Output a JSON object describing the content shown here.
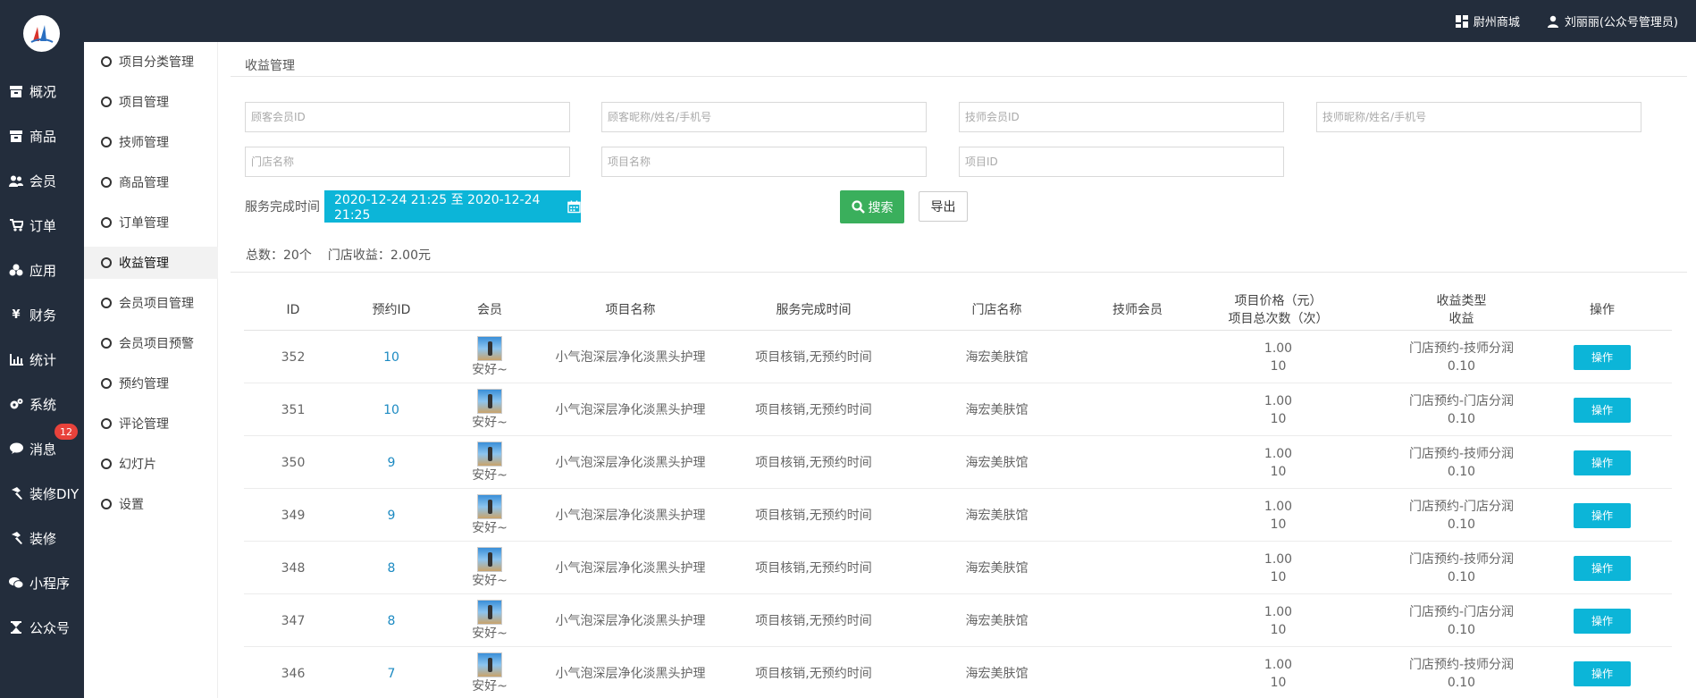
{
  "header": {
    "shop_label": "尉州商城",
    "user_label": "刘丽丽(公众号管理员)"
  },
  "leftnav": {
    "items": [
      {
        "label": "概况",
        "icon": "dashboard-icon"
      },
      {
        "label": "商品",
        "icon": "goods-icon"
      },
      {
        "label": "会员",
        "icon": "users-icon"
      },
      {
        "label": "订单",
        "icon": "cart-icon"
      },
      {
        "label": "应用",
        "icon": "apps-icon"
      },
      {
        "label": "财务",
        "icon": "yen-icon"
      },
      {
        "label": "统计",
        "icon": "chart-icon"
      },
      {
        "label": "系统",
        "icon": "gear-icon"
      },
      {
        "label": "消息",
        "icon": "message-icon"
      },
      {
        "label": "装修DIY",
        "icon": "hammer-icon"
      },
      {
        "label": "装修",
        "icon": "hammer-icon"
      },
      {
        "label": "小程序",
        "icon": "wechat-icon"
      },
      {
        "label": "公众号",
        "icon": "hourglass-icon"
      }
    ],
    "message_badge": "12"
  },
  "subnav": {
    "items": [
      {
        "label": "项目分类管理"
      },
      {
        "label": "项目管理"
      },
      {
        "label": "技师管理"
      },
      {
        "label": "商品管理"
      },
      {
        "label": "订单管理"
      },
      {
        "label": "收益管理"
      },
      {
        "label": "会员项目管理"
      },
      {
        "label": "会员项目预警"
      },
      {
        "label": "预约管理"
      },
      {
        "label": "评论管理"
      },
      {
        "label": "幻灯片"
      },
      {
        "label": "设置"
      }
    ],
    "active_index": 5
  },
  "page": {
    "title": "收益管理"
  },
  "filters": {
    "customer_id": {
      "placeholder": "顾客会员ID",
      "value": ""
    },
    "customer_name": {
      "placeholder": "顾客昵称/姓名/手机号",
      "value": ""
    },
    "tech_id": {
      "placeholder": "技师会员ID",
      "value": ""
    },
    "tech_name": {
      "placeholder": "技师昵称/姓名/手机号",
      "value": ""
    },
    "store_name": {
      "placeholder": "门店名称",
      "value": ""
    },
    "project_name": {
      "placeholder": "项目名称",
      "value": ""
    },
    "project_id": {
      "placeholder": "项目ID",
      "value": ""
    },
    "date_label": "服务完成时间",
    "date_range": "2020-12-24 21:25 至 2020-12-24 21:25",
    "search_label": "搜索",
    "export_label": "导出"
  },
  "summary": {
    "total": "总数：20个",
    "store_income": "门店收益：2.00元"
  },
  "table": {
    "headers": {
      "id": "ID",
      "booking_id": "预约ID",
      "member": "会员",
      "project_name": "项目名称",
      "finish_time": "服务完成时间",
      "store_name": "门店名称",
      "tech_member": "技师会员",
      "price_line1": "项目价格（元）",
      "price_line2": "项目总次数（次）",
      "type_line1": "收益类型",
      "type_line2": "收益",
      "action": "操作"
    },
    "rows": [
      {
        "id": "352",
        "booking_id": "10",
        "member": "安好~",
        "project": "小气泡深层净化淡黑头护理",
        "finish": "项目核销,无预约时间",
        "store": "海宏美肤馆",
        "tech": "",
        "price": "1.00",
        "count": "10",
        "type": "门店预约-技师分润",
        "income": "0.10",
        "action": "操作"
      },
      {
        "id": "351",
        "booking_id": "10",
        "member": "安好~",
        "project": "小气泡深层净化淡黑头护理",
        "finish": "项目核销,无预约时间",
        "store": "海宏美肤馆",
        "tech": "",
        "price": "1.00",
        "count": "10",
        "type": "门店预约-门店分润",
        "income": "0.10",
        "action": "操作"
      },
      {
        "id": "350",
        "booking_id": "9",
        "member": "安好~",
        "project": "小气泡深层净化淡黑头护理",
        "finish": "项目核销,无预约时间",
        "store": "海宏美肤馆",
        "tech": "",
        "price": "1.00",
        "count": "10",
        "type": "门店预约-技师分润",
        "income": "0.10",
        "action": "操作"
      },
      {
        "id": "349",
        "booking_id": "9",
        "member": "安好~",
        "project": "小气泡深层净化淡黑头护理",
        "finish": "项目核销,无预约时间",
        "store": "海宏美肤馆",
        "tech": "",
        "price": "1.00",
        "count": "10",
        "type": "门店预约-门店分润",
        "income": "0.10",
        "action": "操作"
      },
      {
        "id": "348",
        "booking_id": "8",
        "member": "安好~",
        "project": "小气泡深层净化淡黑头护理",
        "finish": "项目核销,无预约时间",
        "store": "海宏美肤馆",
        "tech": "",
        "price": "1.00",
        "count": "10",
        "type": "门店预约-技师分润",
        "income": "0.10",
        "action": "操作"
      },
      {
        "id": "347",
        "booking_id": "8",
        "member": "安好~",
        "project": "小气泡深层净化淡黑头护理",
        "finish": "项目核销,无预约时间",
        "store": "海宏美肤馆",
        "tech": "",
        "price": "1.00",
        "count": "10",
        "type": "门店预约-门店分润",
        "income": "0.10",
        "action": "操作"
      },
      {
        "id": "346",
        "booking_id": "7",
        "member": "安好~",
        "project": "小气泡深层净化淡黑头护理",
        "finish": "项目核销,无预约时间",
        "store": "海宏美肤馆",
        "tech": "",
        "price": "1.00",
        "count": "10",
        "type": "门店预约-技师分润",
        "income": "0.10",
        "action": "操作"
      }
    ]
  },
  "colors": {
    "nav_bg": "#232d3c",
    "accent": "#0cb5d8",
    "search_green": "#3aaf5c",
    "link_blue": "#1c8ac2",
    "badge_red": "#e8423b"
  }
}
